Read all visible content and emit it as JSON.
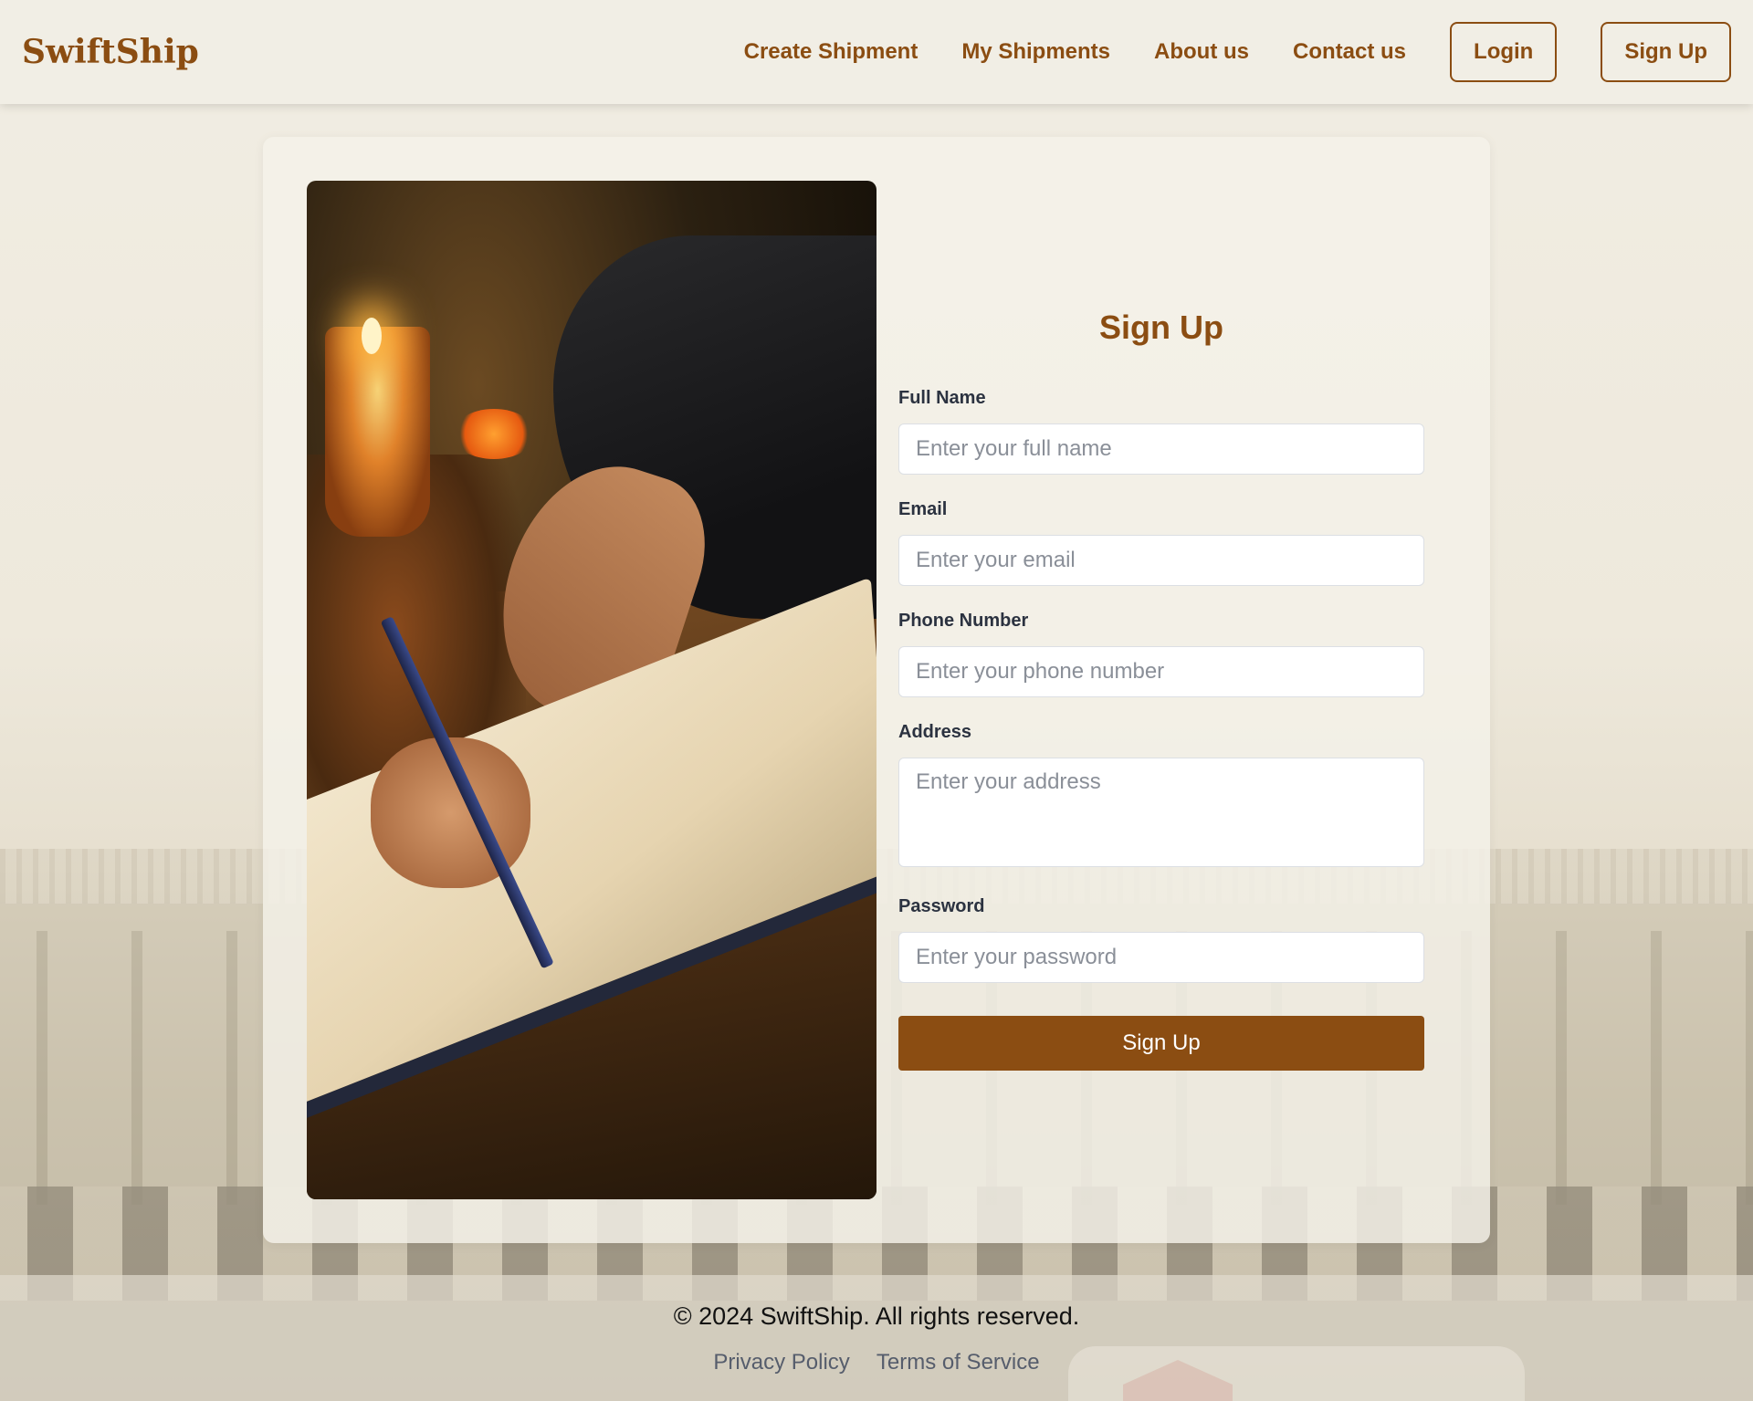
{
  "header": {
    "brand": "SwiftShip",
    "nav": {
      "create_shipment": "Create Shipment",
      "my_shipments": "My Shipments",
      "about": "About us",
      "contact": "Contact us"
    },
    "login_label": "Login",
    "signup_label": "Sign Up"
  },
  "form": {
    "title": "Sign Up",
    "full_name": {
      "label": "Full Name",
      "placeholder": "Enter your full name"
    },
    "email": {
      "label": "Email",
      "placeholder": "Enter your email"
    },
    "phone": {
      "label": "Phone Number",
      "placeholder": "Enter your phone number"
    },
    "address": {
      "label": "Address",
      "placeholder": "Enter your address"
    },
    "password": {
      "label": "Password",
      "placeholder": "Enter your password"
    },
    "submit_label": "Sign Up"
  },
  "footer": {
    "copyright": "© 2024 SwiftShip. All rights reserved.",
    "privacy": "Privacy Policy",
    "terms": "Terms of Service"
  },
  "colors": {
    "brand": "#8b4d12",
    "label": "#2b3240",
    "background": "#f1eee5"
  }
}
